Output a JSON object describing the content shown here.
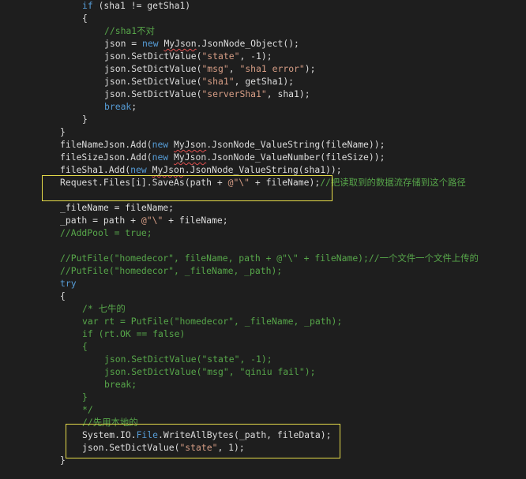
{
  "code_lines": [
    {
      "indent": 4,
      "tokens": [
        {
          "c": "kw",
          "t": "if"
        },
        {
          "c": "pl",
          "t": " (sha1 != getSha1)"
        }
      ]
    },
    {
      "indent": 4,
      "tokens": [
        {
          "c": "pl",
          "t": "{"
        }
      ]
    },
    {
      "indent": 8,
      "tokens": [
        {
          "c": "cmt",
          "t": "//sha1不对"
        }
      ]
    },
    {
      "indent": 8,
      "tokens": [
        {
          "c": "pl",
          "t": "json = "
        },
        {
          "c": "kw",
          "t": "new"
        },
        {
          "c": "pl",
          "t": " "
        },
        {
          "c": "pl squig",
          "t": "MyJson"
        },
        {
          "c": "pl",
          "t": ".JsonNode_Object();"
        }
      ]
    },
    {
      "indent": 8,
      "tokens": [
        {
          "c": "pl",
          "t": "json.SetDictValue("
        },
        {
          "c": "str",
          "t": "\"state\""
        },
        {
          "c": "pl",
          "t": ", -1);"
        }
      ]
    },
    {
      "indent": 8,
      "tokens": [
        {
          "c": "pl",
          "t": "json.SetDictValue("
        },
        {
          "c": "str",
          "t": "\"msg\""
        },
        {
          "c": "pl",
          "t": ", "
        },
        {
          "c": "str",
          "t": "\"sha1 error\""
        },
        {
          "c": "pl",
          "t": ");"
        }
      ]
    },
    {
      "indent": 8,
      "tokens": [
        {
          "c": "pl",
          "t": "json.SetDictValue("
        },
        {
          "c": "str",
          "t": "\"sha1\""
        },
        {
          "c": "pl",
          "t": ", getSha1);"
        }
      ]
    },
    {
      "indent": 8,
      "tokens": [
        {
          "c": "pl",
          "t": "json.SetDictValue("
        },
        {
          "c": "str",
          "t": "\"serverSha1\""
        },
        {
          "c": "pl",
          "t": ", sha1);"
        }
      ]
    },
    {
      "indent": 8,
      "tokens": [
        {
          "c": "kw",
          "t": "break"
        },
        {
          "c": "pl",
          "t": ";"
        }
      ]
    },
    {
      "indent": 4,
      "tokens": [
        {
          "c": "pl",
          "t": "}"
        }
      ]
    },
    {
      "indent": 0,
      "tokens": [
        {
          "c": "pl",
          "t": "}"
        }
      ]
    },
    {
      "indent": 0,
      "tokens": [
        {
          "c": "pl",
          "t": "fileNameJson.Add("
        },
        {
          "c": "kw",
          "t": "new"
        },
        {
          "c": "pl",
          "t": " "
        },
        {
          "c": "pl squig",
          "t": "MyJson"
        },
        {
          "c": "pl",
          "t": ".JsonNode_ValueString(fileName));"
        }
      ]
    },
    {
      "indent": 0,
      "tokens": [
        {
          "c": "pl",
          "t": "fileSizeJson.Add("
        },
        {
          "c": "kw",
          "t": "new"
        },
        {
          "c": "pl",
          "t": " "
        },
        {
          "c": "pl squig",
          "t": "MyJson"
        },
        {
          "c": "pl",
          "t": ".JsonNode_ValueNumber(fileSize));"
        }
      ]
    },
    {
      "indent": 0,
      "tokens": [
        {
          "c": "pl",
          "t": "fileSha1.Add("
        },
        {
          "c": "kw",
          "t": "new"
        },
        {
          "c": "pl",
          "t": " "
        },
        {
          "c": "pl squig",
          "t": "MyJson"
        },
        {
          "c": "pl",
          "t": ".JsonNode_ValueString(sha1));"
        }
      ]
    },
    {
      "indent": 0,
      "tokens": [
        {
          "c": "pl",
          "t": "Request.Files[i].SaveAs(path + "
        },
        {
          "c": "str",
          "t": "@\"\\\""
        },
        {
          "c": "pl",
          "t": " + fileName);"
        },
        {
          "c": "cmt",
          "t": "//把读取到的数据流存储到这个路径"
        }
      ]
    },
    {
      "indent": 0,
      "tokens": []
    },
    {
      "indent": 0,
      "tokens": [
        {
          "c": "pl",
          "t": "_fileName = fileName;"
        }
      ]
    },
    {
      "indent": 0,
      "tokens": [
        {
          "c": "pl",
          "t": "_path = path + "
        },
        {
          "c": "str",
          "t": "@\"\\\""
        },
        {
          "c": "pl",
          "t": " + fileName;"
        }
      ]
    },
    {
      "indent": 0,
      "tokens": [
        {
          "c": "cmt",
          "t": "//AddPool = true;"
        }
      ]
    },
    {
      "indent": 0,
      "tokens": []
    },
    {
      "indent": 0,
      "tokens": [
        {
          "c": "cmt",
          "t": "//PutFile(\"homedecor\", fileName, path + @\"\\\" + fileName);//一个文件一个文件上传的"
        }
      ]
    },
    {
      "indent": 0,
      "tokens": [
        {
          "c": "cmt",
          "t": "//PutFile(\"homedecor\", _fileName, _path);"
        }
      ]
    },
    {
      "indent": 0,
      "tokens": [
        {
          "c": "kw",
          "t": "try"
        }
      ]
    },
    {
      "indent": 0,
      "tokens": [
        {
          "c": "pl",
          "t": "{"
        }
      ]
    },
    {
      "indent": 4,
      "tokens": [
        {
          "c": "cmt",
          "t": "/* 七牛的"
        }
      ]
    },
    {
      "indent": 4,
      "tokens": [
        {
          "c": "cmt",
          "t": "var rt = PutFile(\"homedecor\", _fileName, _path);"
        }
      ]
    },
    {
      "indent": 4,
      "tokens": [
        {
          "c": "cmt",
          "t": "if (rt.OK == false)"
        }
      ]
    },
    {
      "indent": 4,
      "tokens": [
        {
          "c": "cmt",
          "t": "{"
        }
      ]
    },
    {
      "indent": 8,
      "tokens": [
        {
          "c": "cmt",
          "t": "json.SetDictValue(\"state\", -1);"
        }
      ]
    },
    {
      "indent": 8,
      "tokens": [
        {
          "c": "cmt",
          "t": "json.SetDictValue(\"msg\", \"qiniu fail\");"
        }
      ]
    },
    {
      "indent": 8,
      "tokens": [
        {
          "c": "cmt",
          "t": "break;"
        }
      ]
    },
    {
      "indent": 4,
      "tokens": [
        {
          "c": "cmt",
          "t": "}"
        }
      ]
    },
    {
      "indent": 4,
      "tokens": [
        {
          "c": "cmt",
          "t": "*/"
        }
      ]
    },
    {
      "indent": 4,
      "tokens": [
        {
          "c": "cmt",
          "t": "//先用本地的"
        }
      ]
    },
    {
      "indent": 4,
      "tokens": [
        {
          "c": "pl",
          "t": "System.IO."
        },
        {
          "c": "kw",
          "t": "File"
        },
        {
          "c": "pl",
          "t": ".WriteAllBytes(_path, fileData);"
        }
      ]
    },
    {
      "indent": 4,
      "tokens": [
        {
          "c": "pl",
          "t": "json.SetDictValue("
        },
        {
          "c": "str",
          "t": "\"state\""
        },
        {
          "c": "pl",
          "t": ", 1);"
        }
      ]
    },
    {
      "indent": 0,
      "tokens": [
        {
          "c": "pl",
          "t": "}"
        }
      ]
    },
    {
      "indent": 4,
      "tokens": [
        {
          "c": "pl",
          "t": "        "
        }
      ]
    }
  ],
  "colors": {
    "background": "#1e1e1e",
    "keyword": "#569cd6",
    "string": "#d69d85",
    "comment": "#57a64a",
    "plain": "#dcdcdc",
    "highlight_box": "#e6dc4a"
  }
}
